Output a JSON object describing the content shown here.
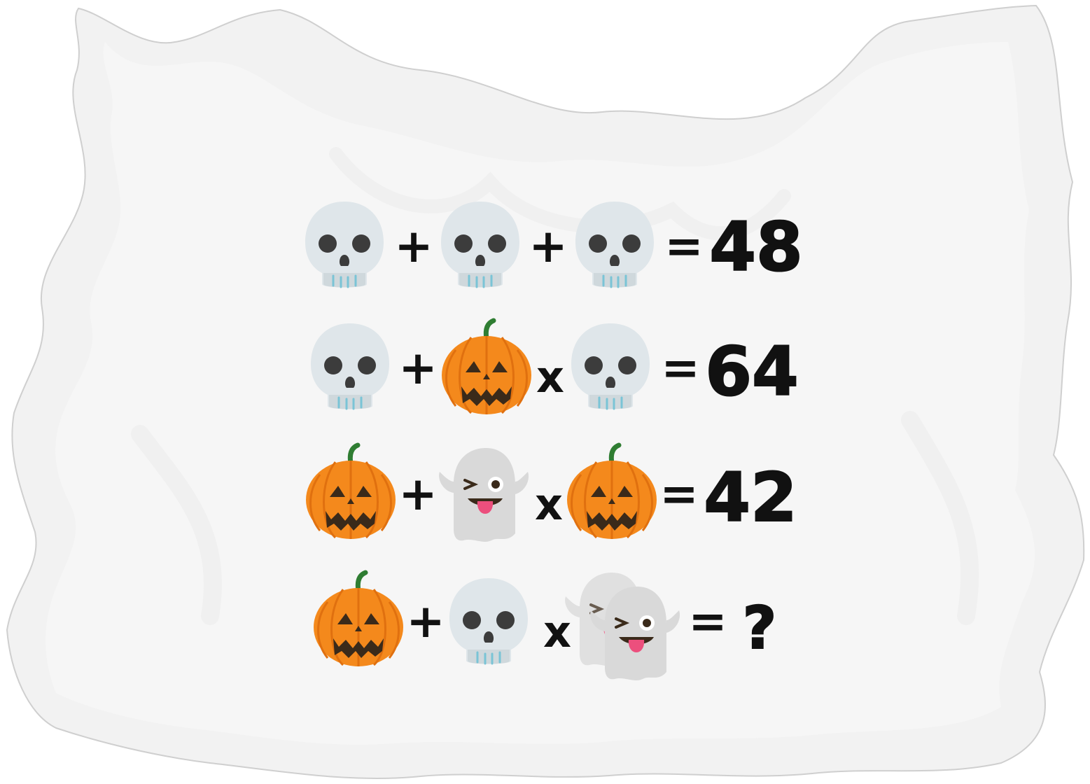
{
  "puzzle": {
    "colors": {
      "background": "#ffffff",
      "sheet": "#f2f2f2",
      "sheet_edge": "#cfcfcf",
      "ink": "#111111",
      "skull": "#dfe6ea",
      "pumpkin": "#f4891c",
      "ghost": "#d9d9d9"
    },
    "rows": [
      {
        "terms": [
          "skull-icon",
          "skull-icon",
          "skull-icon"
        ],
        "operators": [
          "+",
          "+"
        ],
        "equals": "=",
        "result": "48"
      },
      {
        "terms": [
          "skull-icon",
          "pumpkin-icon",
          "skull-icon"
        ],
        "operators": [
          "+",
          "x"
        ],
        "equals": "=",
        "result": "64"
      },
      {
        "terms": [
          "pumpkin-icon",
          "ghost-icon",
          "pumpkin-icon"
        ],
        "operators": [
          "+",
          "x"
        ],
        "equals": "=",
        "result": "42"
      },
      {
        "terms": [
          "pumpkin-icon",
          "skull-icon",
          "double-ghost-icon"
        ],
        "operators": [
          "+",
          "x"
        ],
        "equals": "=",
        "result": "?"
      }
    ]
  }
}
